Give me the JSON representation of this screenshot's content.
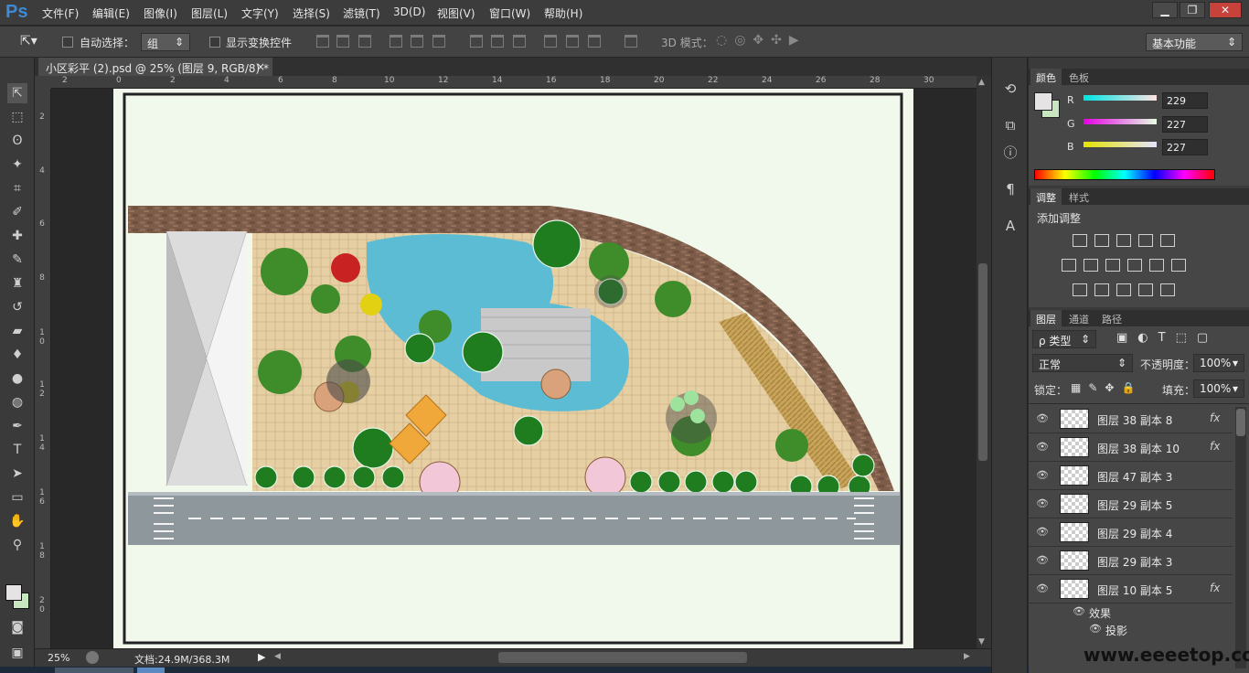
{
  "app": {
    "logo": "Ps"
  },
  "menu": [
    "文件(F)",
    "编辑(E)",
    "图像(I)",
    "图层(L)",
    "文字(Y)",
    "选择(S)",
    "滤镜(T)",
    "3D(D)",
    "视图(V)",
    "窗口(W)",
    "帮助(H)"
  ],
  "window_buttons": {
    "minimize": "▁",
    "restore": "❐",
    "close": "✕"
  },
  "options": {
    "auto_select_label": "自动选择：",
    "auto_select_value": "组",
    "show_transform_label": "显示变换控件",
    "mode_3d_label": "3D 模式：",
    "workspace": "基本功能"
  },
  "document_tab": {
    "title": "小区彩平 (2).psd @ 25% (图层 9, RGB/8) *",
    "close": "×"
  },
  "ruler_top": [
    "2",
    "0",
    "2",
    "4",
    "6",
    "8",
    "10",
    "12",
    "14",
    "16",
    "18",
    "20",
    "22",
    "24",
    "26",
    "28",
    "30"
  ],
  "ruler_left": [
    "2",
    "4",
    "6",
    "8",
    "1 0",
    "1 2",
    "1 4",
    "1 6",
    "1 8",
    "2 0"
  ],
  "status": {
    "zoom": "25%",
    "doc": "文档:24.9M/368.3M"
  },
  "color_panel": {
    "tabs": [
      "颜色",
      "色板"
    ],
    "channels": [
      {
        "name": "R",
        "value": "229"
      },
      {
        "name": "G",
        "value": "227"
      },
      {
        "name": "B",
        "value": "227"
      }
    ],
    "fg_color": "#e5e3e3",
    "bg_color": "#c8e6c0"
  },
  "adjust_panel": {
    "tabs": [
      "调整",
      "样式"
    ],
    "title": "添加调整"
  },
  "layers_panel": {
    "tabs": [
      "图层",
      "通道",
      "路径"
    ],
    "filter_label": "ρ 类型",
    "blend_mode": "正常",
    "opacity_label": "不透明度：",
    "opacity": "100%",
    "lock_label": "锁定：",
    "fill_label": "填充：",
    "fill": "100%",
    "layers": [
      {
        "name": "图层 38 副本 8",
        "fx": "fx"
      },
      {
        "name": "图层 38 副本 10",
        "fx": "fx"
      },
      {
        "name": "图层 47 副本 3",
        "fx": ""
      },
      {
        "name": "图层 29 副本 5",
        "fx": ""
      },
      {
        "name": "图层 29 副本 4",
        "fx": ""
      },
      {
        "name": "图层 29 副本 3",
        "fx": ""
      },
      {
        "name": "图层 10 副本 5",
        "fx": "fx"
      }
    ],
    "effects_label": "效果",
    "effect_item": "投影"
  },
  "watermark": "www.eeeetop.com"
}
